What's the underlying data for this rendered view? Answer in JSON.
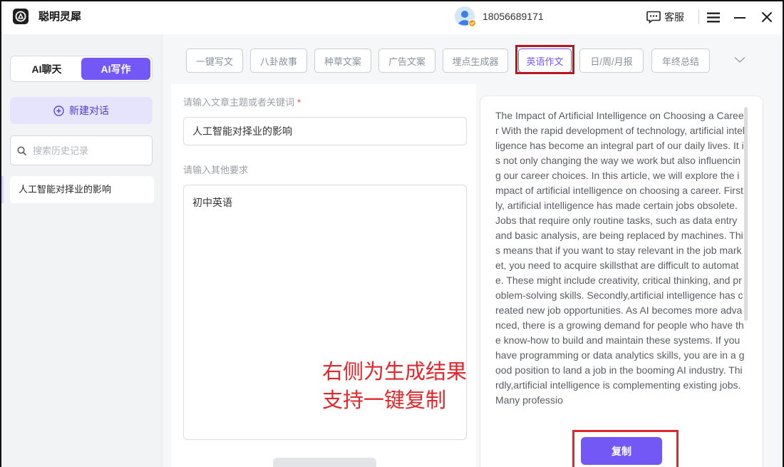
{
  "app": {
    "title": "聪明灵犀",
    "phone": "18056689171",
    "service_label": "客服"
  },
  "icons": {
    "logo": "app-logo-icon",
    "avatar": "user-avatar-icon",
    "service": "chat-bubble-icon",
    "menu": "hamburger-menu-icon",
    "minimize": "minimize-icon",
    "close": "close-icon",
    "new_chat": "plus-circle-icon",
    "search": "search-icon",
    "tabs_more": "chevron-down-icon"
  },
  "colors": {
    "accent": "#7358f6",
    "accent_light": "#e6e3fc",
    "accent_text": "#4f3dc8",
    "annotation_red": "#e3262b",
    "annotation_dark_red": "#b9161d"
  },
  "sidebar": {
    "mode_toggle": [
      {
        "label": "AI聊天",
        "active": false
      },
      {
        "label": "AI写作",
        "active": true
      }
    ],
    "new_chat_label": "新建对话",
    "search_placeholder": "搜索历史记录",
    "history": [
      {
        "title": "人工智能对择业的影响",
        "active": true
      }
    ]
  },
  "tabs": [
    {
      "label": "一键写文",
      "active": false
    },
    {
      "label": "八卦故事",
      "active": false
    },
    {
      "label": "种草文案",
      "active": false
    },
    {
      "label": "广告文案",
      "active": false
    },
    {
      "label": "埋点生成器",
      "active": false
    },
    {
      "label": "英语作文",
      "active": true
    },
    {
      "label": "日/周/月报",
      "active": false
    },
    {
      "label": "年终总结",
      "active": false
    }
  ],
  "form": {
    "topic_label": "请输入文章主题或者关键词",
    "required_mark": "*",
    "topic_value": "人工智能对择业的影响",
    "requirements_label": "请输入其他要求",
    "requirements_value": "初中英语"
  },
  "result": {
    "text": "The Impact of Artificial Intelligence on Choosing a Career With the rapid development of technology, artificial intelligence has become an integral part of our daily lives. It is not only changing the way we work but also influencing our career choices. In this article, we will explore the impact of artificial intelligence on choosing a career. Firstly, artificial intelligence has made certain jobs obsolete. Jobs that require only routine tasks, such as data entry and basic analysis, are being replaced by machines. This means that if you want to stay relevant in the job market, you need to acquire skillsthat are difficult to automate. These might include creativity, critical thinking, and problem-solving skills. Secondly,artificial intelligence has created new job opportunities. As AI becomes more advanced, there is a growing demand for people who have the know-how to build and maintain these systems. If you have programming or data analytics skills, you are in a good position to land a job in the booming AI industry. Thirdly,artificial intelligence is complementing existing jobs. Many professio",
    "copy_label": "复制"
  },
  "annotation": {
    "lines": [
      "右侧为生成结果",
      "支持一键复制"
    ]
  }
}
